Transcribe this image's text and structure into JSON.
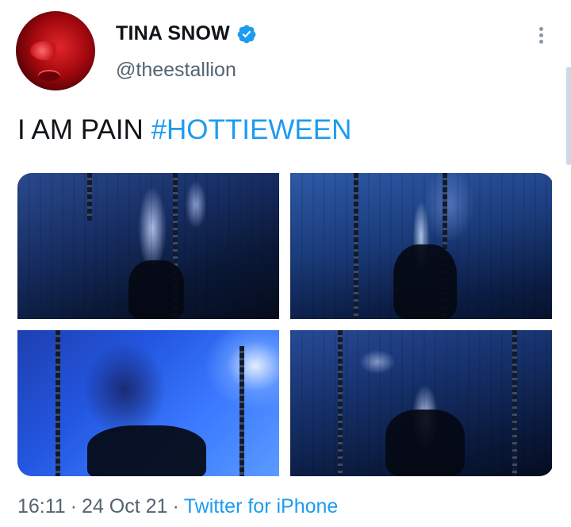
{
  "author": {
    "display_name": "TINA SNOW",
    "handle": "@theestallion",
    "verified": true,
    "verified_icon": "verified-badge-icon",
    "avatar_icon": "profile-avatar"
  },
  "menu": {
    "icon": "more-vertical-icon"
  },
  "tweet": {
    "text": "I AM PAIN ",
    "hashtag": "#HOTTIEWEEN"
  },
  "media": {
    "photos": [
      "photo-1",
      "photo-2",
      "photo-3",
      "photo-4"
    ]
  },
  "meta": {
    "time": "16:11",
    "separator": "·",
    "date": "24 Oct 21",
    "source": "Twitter for iPhone"
  },
  "colors": {
    "accent": "#1d9bf0",
    "secondary_text": "#536471",
    "primary_text": "#0f1419"
  }
}
